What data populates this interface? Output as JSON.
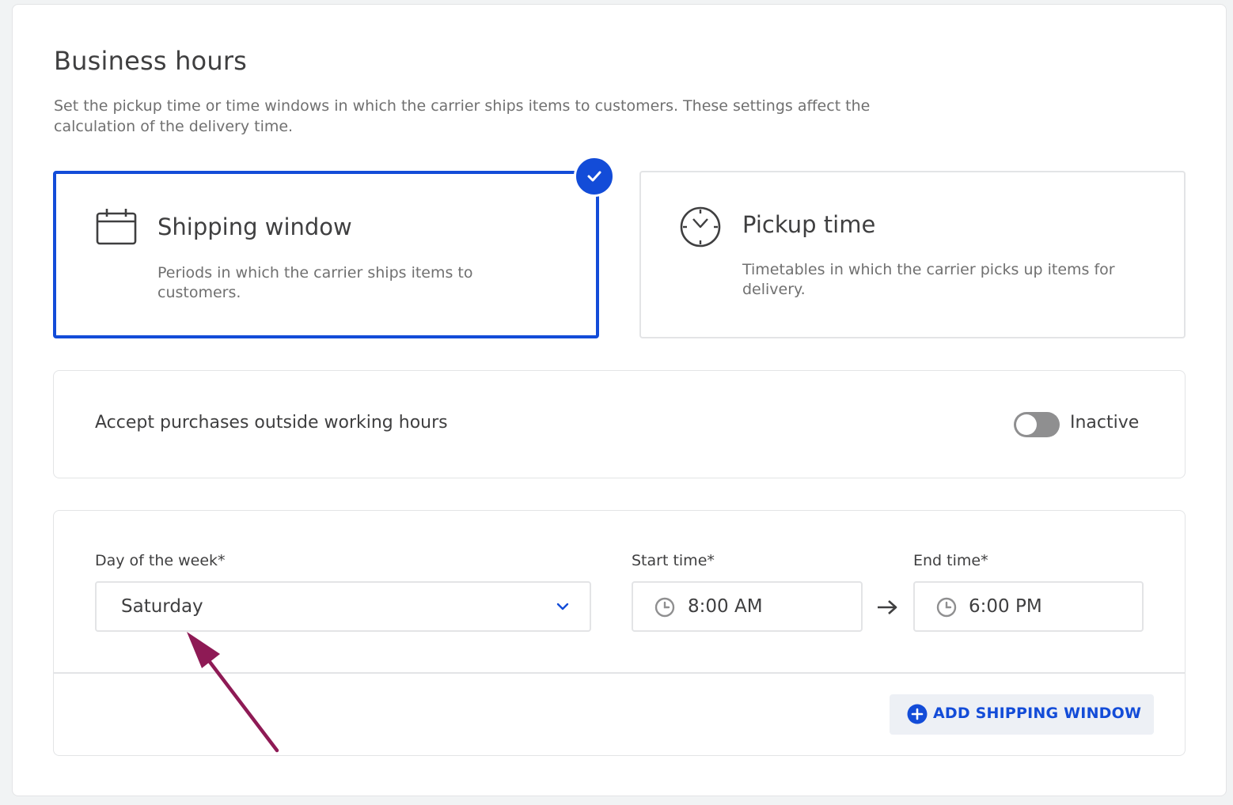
{
  "header": {
    "title": "Business hours",
    "description": "Set the pickup time or time windows in which the carrier ships items to customers. These settings affect the calculation of the delivery time."
  },
  "options": {
    "shipping_window": {
      "icon": "calendar-icon",
      "title": "Shipping window",
      "description": "Periods in which the carrier ships items to customers.",
      "selected": true
    },
    "pickup_time": {
      "icon": "clock-icon",
      "title": "Pickup time",
      "description": "Timetables in which the carrier picks up items for delivery.",
      "selected": false
    }
  },
  "outside_hours": {
    "label": "Accept purchases outside working hours",
    "status": "Inactive",
    "enabled": false
  },
  "shipping_window_form": {
    "day_label": "Day of the week*",
    "day_value": "Saturday",
    "start_label": "Start time*",
    "start_value": "8:00 AM",
    "end_label": "End time*",
    "end_value": "6:00 PM",
    "add_button": "ADD SHIPPING WINDOW"
  },
  "colors": {
    "accent": "#134cd8",
    "annotation": "#8e1a55",
    "toggle_off": "#8f8f90"
  }
}
